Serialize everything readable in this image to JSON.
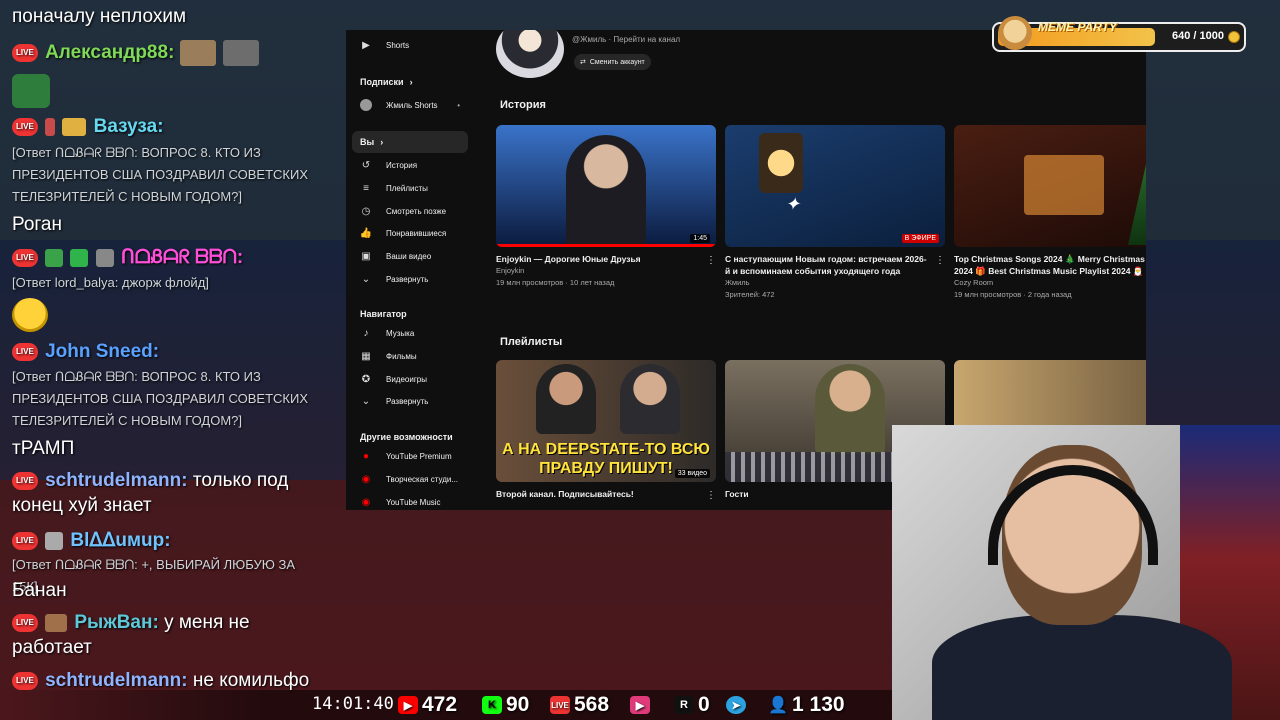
{
  "chat": {
    "top_text": "поначалу неплохим",
    "lines": [
      {
        "nick": "Александр88:",
        "color": "#7ed957",
        "msg": ""
      },
      {
        "nick": "Вазуза:",
        "color": "#66d9ef",
        "msg": ""
      },
      {
        "nick": "ᑎᗝᏰᗩᖇ ᗷᗷᑎ:",
        "color": "#ff4fd8",
        "msg": ""
      },
      {
        "nick": "John Sneed:",
        "color": "#5aa2ff",
        "msg": ""
      },
      {
        "nick": "schtrudelmann:",
        "color": "#8fb4ff",
        "msg": "только под конец хуй знает"
      },
      {
        "nick": "Blᐃᐃuмuр:",
        "color": "#6fc3ff",
        "msg": ""
      },
      {
        "nick": "РыжВан:",
        "color": "#5cc8d8",
        "msg": "у меня не работает"
      },
      {
        "nick": "schtrudelmann:",
        "color": "#8fb4ff",
        "msg": "не комильфо"
      }
    ],
    "reply1": "[Ответ ᑎᗝᏰᗩᖇ ᗷᗷᑎ: ВОПРОС 8. КТО ИЗ ПРЕЗИДЕНТОВ США ПОЗДРАВИЛ СОВЕТСКИХ ТЕЛЕЗРИТЕЛЕЙ С НОВЫМ ГОДОМ?]",
    "answer1": "Роган",
    "reply2": "[Ответ lord_balya: джорж флойд]",
    "reply3": "[Ответ ᑎᗝᏰᗩᖇ ᗷᗷᑎ: ВОПРОС 8. КТО ИЗ ПРЕЗИДЕНТОВ США ПОЗДРАВИЛ СОВЕТСКИХ ТЕЛЕЗРИТЕЛЕЙ С НОВЫМ ГОДОМ?]",
    "answer3": "тРАМП",
    "reply4": "[Ответ ᑎᗝᏰᗩᖇ ᗷᗷᑎ: +, ВЫБИРАЙ ЛЮБУЮ ЗА 15К]",
    "answer4": "Банан",
    "live_label": "LIVE"
  },
  "youtube": {
    "sidebar": {
      "shorts": "Shorts",
      "subscriptions": "Подписки",
      "sub_channel": "Жмиль Shorts",
      "you": "Вы",
      "items": [
        "История",
        "Плейлисты",
        "Смотреть позже",
        "Понравившиеся",
        "Ваши видео",
        "Развернуть"
      ],
      "navigator": "Навигатор",
      "nav_items": [
        "Музыка",
        "Фильмы",
        "Видеоигры",
        "Развернуть"
      ],
      "other": "Другие возможности",
      "other_items": [
        "YouTube Premium",
        "Творческая студи...",
        "YouTube Music"
      ]
    },
    "channel": {
      "handle": "@Жмиль · Перейти на канал",
      "switch": "Сменить аккаунт"
    },
    "history_title": "История",
    "history": [
      {
        "title": "Enjoykin — Дорогие Юные Друзья",
        "channel": "Enjoykin",
        "meta": "19 млн просмотров · 10 лет назад",
        "duration": "1:45",
        "color1": "#3a73c9",
        "color2": "#0b1a3d"
      },
      {
        "title": "С наступающим Новым годом: встречаем 2026-й и вспоминаем события уходящего года",
        "channel": "Жмиль",
        "meta": "Зрителей: 472",
        "duration": "В ЭФИРЕ",
        "color1": "#1b3d6e",
        "color2": "#0b1f3c"
      },
      {
        "title": "Top Christmas Songs 2024 🎄 Merry Christmas 2024 🎁 Best Christmas Music Playlist 2024 🎅",
        "channel": "Cozy Room",
        "meta": "19 млн просмотров · 2 года назад",
        "duration": "",
        "color1": "#4a1e12",
        "color2": "#1c0a06"
      }
    ],
    "playlists_title": "Плейлисты",
    "playlists": [
      {
        "title": "Второй канал. Подписывайтесь!",
        "banner": "А НА DEEPSTATE-ТО ВСЮ ПРАВДУ ПИШУТ!",
        "count": "33 видео",
        "color1": "#6a4f3a",
        "color2": "#2d2a28"
      },
      {
        "title": "Гости",
        "banner": "",
        "count": "",
        "color1": "#7a7060",
        "color2": "#3b352d"
      },
      {
        "title": "",
        "banner": "",
        "count": "",
        "color1": "#c8a66e",
        "color2": "#6e5a3d"
      }
    ]
  },
  "meme_party": {
    "label": "MEME PARTY",
    "count": "640 / 1000",
    "progress": 0.64
  },
  "stats": {
    "clock": "14:01:40",
    "youtube": "472",
    "kick": "90",
    "vk": "568",
    "twitch": "",
    "rutube": "0",
    "telegram": "",
    "total": "1 130"
  }
}
